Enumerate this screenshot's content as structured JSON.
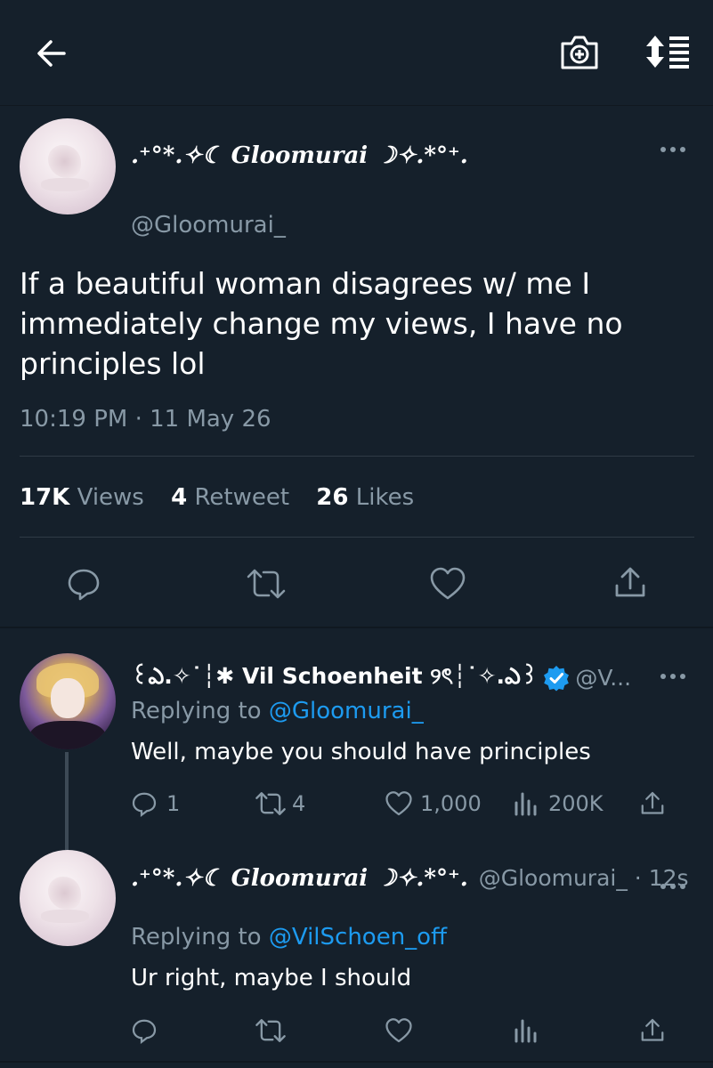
{
  "topbar": {
    "back_icon": "arrow-left-icon",
    "camera_icon": "camera-plus-icon",
    "sort_icon": "sort-list-icon"
  },
  "main_tweet": {
    "display_name": ".⁺˚*•̩̩͙✩•̩̩͙*˚⁺‧͙⁺˚*•̩̩͙✩ ☾ Gloomurai ☽ ✩•̩̩͙*˚⁺",
    "display_name_short": ".⁺°*.✧☾ Gloomurai ☽✧.*°⁺.",
    "handle": "@Gloomurai_",
    "text_line1": "If a beautiful woman disagrees w/ me I",
    "text_line2": "immediately change my views, I have no",
    "text_line3": "principles lol",
    "timestamp": "10:19 PM · 11 May 26",
    "more_icon": "more-horizontal-icon"
  },
  "stats": {
    "views_count": "17K",
    "views_label": "Views",
    "retweet_count": "4",
    "retweet_label": "Retweet",
    "likes_count": "26",
    "likes_label": "Likes"
  },
  "reply1": {
    "display_name": "꒰ఎ.✧˙┆✱ Vil Schoenheit ୨ৎ┆˙✧.ఎ꒱",
    "handle": "@V...",
    "verified_color": "#1d9bf0",
    "replying_prefix": "Replying to",
    "replying_to": "@Gloomurai_",
    "text": "Well, maybe you should have principles",
    "reply_count": "1",
    "retweet_count": "4",
    "like_count": "1,000",
    "view_count": "200K"
  },
  "reply2": {
    "display_name": ".⁺°*.✧☾ Gloomurai ☽✧.*°⁺.",
    "handle_time": "@Gloomurai_ · 12s",
    "replying_prefix": "Replying to",
    "replying_to": "@VilSchoen_off",
    "text": "Ur right, maybe I should"
  },
  "colors": {
    "background": "#15202b",
    "accent": "#1d9bf0",
    "muted": "#8899a6",
    "divider": "#2f3b46"
  }
}
